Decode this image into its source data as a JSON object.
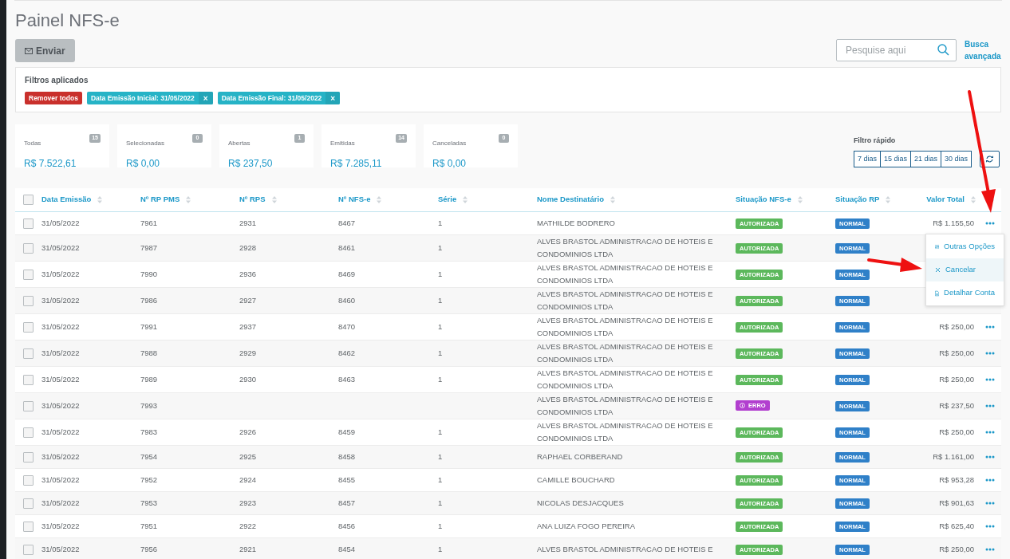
{
  "title": "Painel NFS-e",
  "send_button": "Enviar",
  "search": {
    "placeholder": "Pesquise aqui"
  },
  "advanced_search": "Busca avançada",
  "filters": {
    "title": "Filtros aplicados",
    "clear": "Remover todos",
    "tags": [
      {
        "label": "Data Emissão Inicial: 31/05/2022",
        "remove": "×"
      },
      {
        "label": "Data Emissão Final: 31/05/2022",
        "remove": "×"
      }
    ]
  },
  "summary": [
    {
      "label": "Todas",
      "count": "15",
      "value": "R$ 7.522,61"
    },
    {
      "label": "Selecionadas",
      "count": "0",
      "value": "R$ 0,00"
    },
    {
      "label": "Abertas",
      "count": "1",
      "value": "R$ 237,50"
    },
    {
      "label": "Emitidas",
      "count": "14",
      "value": "R$ 7.285,11"
    },
    {
      "label": "Canceladas",
      "count": "0",
      "value": "R$ 0,00"
    }
  ],
  "quick_filter": {
    "title": "Filtro rápido",
    "options": [
      "7 dias",
      "15 dias",
      "21 dias",
      "30 dias"
    ]
  },
  "table": {
    "select_all": {
      "checked": false
    },
    "columns": [
      "Data Emissão",
      "Nº RP PMS",
      "Nº RPS",
      "Nº NFS-e",
      "Série",
      "Nome Destinatário",
      "Situação NFS-e",
      "Situação RP",
      "Valor Total"
    ],
    "rows": [
      {
        "checked": false,
        "date": "31/05/2022",
        "rp_pms": "7961",
        "rps": "2931",
        "nfse": "8467",
        "serie": "1",
        "name": "MATHILDE BODRERO",
        "status": {
          "label": "AUTORIZADA",
          "kind": "ok"
        },
        "rp_status": "NORMAL",
        "total": "R$ 1.155,50"
      },
      {
        "checked": false,
        "date": "31/05/2022",
        "rp_pms": "7987",
        "rps": "2928",
        "nfse": "8461",
        "serie": "1",
        "name": "ALVES BRASTOL ADMINISTRACAO DE HOTEIS E CONDOMINIOS LTDA",
        "status": {
          "label": "AUTORIZADA",
          "kind": "ok"
        },
        "rp_status": "NORMAL"
      },
      {
        "checked": false,
        "date": "31/05/2022",
        "rp_pms": "7990",
        "rps": "2936",
        "nfse": "8469",
        "serie": "1",
        "name": "ALVES BRASTOL ADMINISTRACAO DE HOTEIS E CONDOMINIOS LTDA",
        "status": {
          "label": "AUTORIZADA",
          "kind": "ok"
        },
        "rp_status": "NORMAL"
      },
      {
        "checked": false,
        "date": "31/05/2022",
        "rp_pms": "7986",
        "rps": "2927",
        "nfse": "8460",
        "serie": "1",
        "name": "ALVES BRASTOL ADMINISTRACAO DE HOTEIS E CONDOMINIOS LTDA",
        "status": {
          "label": "AUTORIZADA",
          "kind": "ok"
        },
        "rp_status": "NORMAL"
      },
      {
        "checked": false,
        "date": "31/05/2022",
        "rp_pms": "7991",
        "rps": "2937",
        "nfse": "8470",
        "serie": "1",
        "name": "ALVES BRASTOL ADMINISTRACAO DE HOTEIS E CONDOMINIOS LTDA",
        "status": {
          "label": "AUTORIZADA",
          "kind": "ok"
        },
        "rp_status": "NORMAL",
        "total": "R$ 250,00"
      },
      {
        "checked": false,
        "date": "31/05/2022",
        "rp_pms": "7988",
        "rps": "2929",
        "nfse": "8462",
        "serie": "1",
        "name": "ALVES BRASTOL ADMINISTRACAO DE HOTEIS E CONDOMINIOS LTDA",
        "status": {
          "label": "AUTORIZADA",
          "kind": "ok"
        },
        "rp_status": "NORMAL",
        "total": "R$ 250,00"
      },
      {
        "checked": false,
        "date": "31/05/2022",
        "rp_pms": "7989",
        "rps": "2930",
        "nfse": "8463",
        "serie": "1",
        "name": "ALVES BRASTOL ADMINISTRACAO DE HOTEIS E CONDOMINIOS LTDA",
        "status": {
          "label": "AUTORIZADA",
          "kind": "ok"
        },
        "rp_status": "NORMAL",
        "total": "R$ 250,00"
      },
      {
        "checked": false,
        "date": "31/05/2022",
        "rp_pms": "7993",
        "name": "ALVES BRASTOL ADMINISTRACAO DE HOTEIS E CONDOMINIOS LTDA",
        "status": {
          "label": "ERRO",
          "kind": "error"
        },
        "rp_status": "NORMAL",
        "total": "R$ 237,50"
      },
      {
        "checked": false,
        "date": "31/05/2022",
        "rp_pms": "7983",
        "rps": "2926",
        "nfse": "8459",
        "serie": "1",
        "name": "ALVES BRASTOL ADMINISTRACAO DE HOTEIS E CONDOMINIOS LTDA",
        "status": {
          "label": "AUTORIZADA",
          "kind": "ok"
        },
        "rp_status": "NORMAL",
        "total": "R$ 250,00"
      },
      {
        "checked": false,
        "date": "31/05/2022",
        "rp_pms": "7954",
        "rps": "2925",
        "nfse": "8458",
        "serie": "1",
        "name": "RAPHAEL CORBERAND",
        "status": {
          "label": "AUTORIZADA",
          "kind": "ok"
        },
        "rp_status": "NORMAL",
        "total": "R$ 1.161,00"
      },
      {
        "checked": false,
        "date": "31/05/2022",
        "rp_pms": "7952",
        "rps": "2924",
        "nfse": "8455",
        "serie": "1",
        "name": "CAMILLE BOUCHARD",
        "status": {
          "label": "AUTORIZADA",
          "kind": "ok"
        },
        "rp_status": "NORMAL",
        "total": "R$ 953,28"
      },
      {
        "checked": false,
        "date": "31/05/2022",
        "rp_pms": "7953",
        "rps": "2923",
        "nfse": "8457",
        "serie": "1",
        "name": "NICOLAS DESJACQUES",
        "status": {
          "label": "AUTORIZADA",
          "kind": "ok"
        },
        "rp_status": "NORMAL",
        "total": "R$ 901,63"
      },
      {
        "checked": false,
        "date": "31/05/2022",
        "rp_pms": "7951",
        "rps": "2922",
        "nfse": "8456",
        "serie": "1",
        "name": "ANA LUIZA FOGO PEREIRA",
        "status": {
          "label": "AUTORIZADA",
          "kind": "ok"
        },
        "rp_status": "NORMAL",
        "total": "R$ 625,40"
      },
      {
        "checked": false,
        "date": "31/05/2022",
        "rp_pms": "7956",
        "rps": "2921",
        "nfse": "8454",
        "serie": "1",
        "name": "ALVES BRASTOL ADMINISTRACAO DE HOTEIS E",
        "status": {
          "label": "AUTORIZADA",
          "kind": "ok"
        },
        "rp_status": "NORMAL",
        "total": "R$ 250,00"
      }
    ]
  },
  "row_menu": [
    {
      "label": "Outras Opções",
      "kind": "options",
      "highlighted": false
    },
    {
      "label": "Cancelar",
      "kind": "cancel",
      "highlighted": true
    },
    {
      "label": "Detalhar Conta",
      "kind": "detail",
      "highlighted": false
    }
  ]
}
